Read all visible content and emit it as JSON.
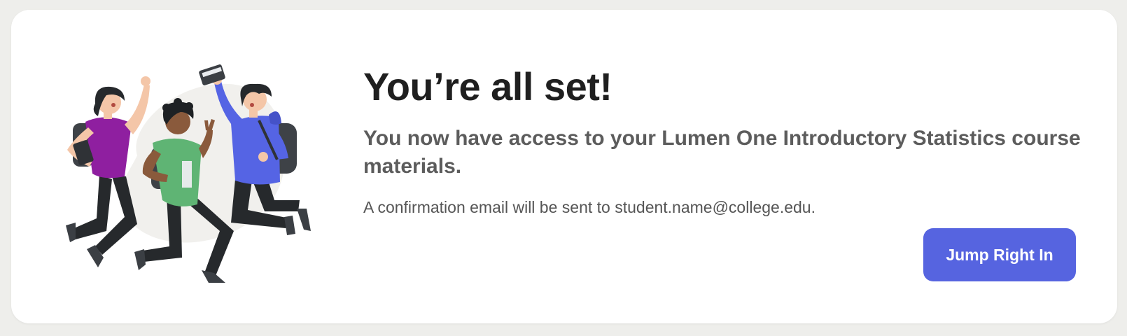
{
  "card": {
    "title": "You’re all set!",
    "subtitle": "You now have access to your Lumen One Introductory Statistics course materials.",
    "note": "A confirmation email will be sent to student.name@college.edu.",
    "cta_label": "Jump Right In"
  },
  "colors": {
    "background": "#eeeeeb",
    "card": "#ffffff",
    "accent": "#5664e0",
    "title_text": "#1f1f1f",
    "body_text": "#5c5c5c"
  },
  "illustration": {
    "icon": "jumping-students-illustration"
  }
}
